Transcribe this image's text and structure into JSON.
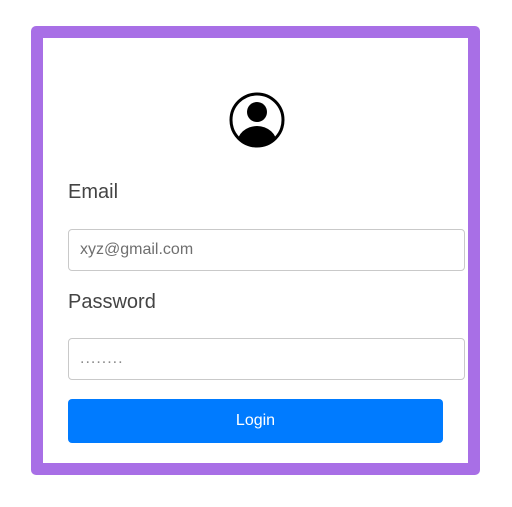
{
  "form": {
    "avatar_icon": "user-circle-icon",
    "email_label": "Email",
    "email_placeholder": "xyz@gmail.com",
    "password_label": "Password",
    "password_placeholder": "........",
    "login_label": "Login"
  },
  "colors": {
    "frame": "#a86fe6",
    "button": "#007bff",
    "button_text": "#ffffff",
    "label_text": "#444444"
  }
}
